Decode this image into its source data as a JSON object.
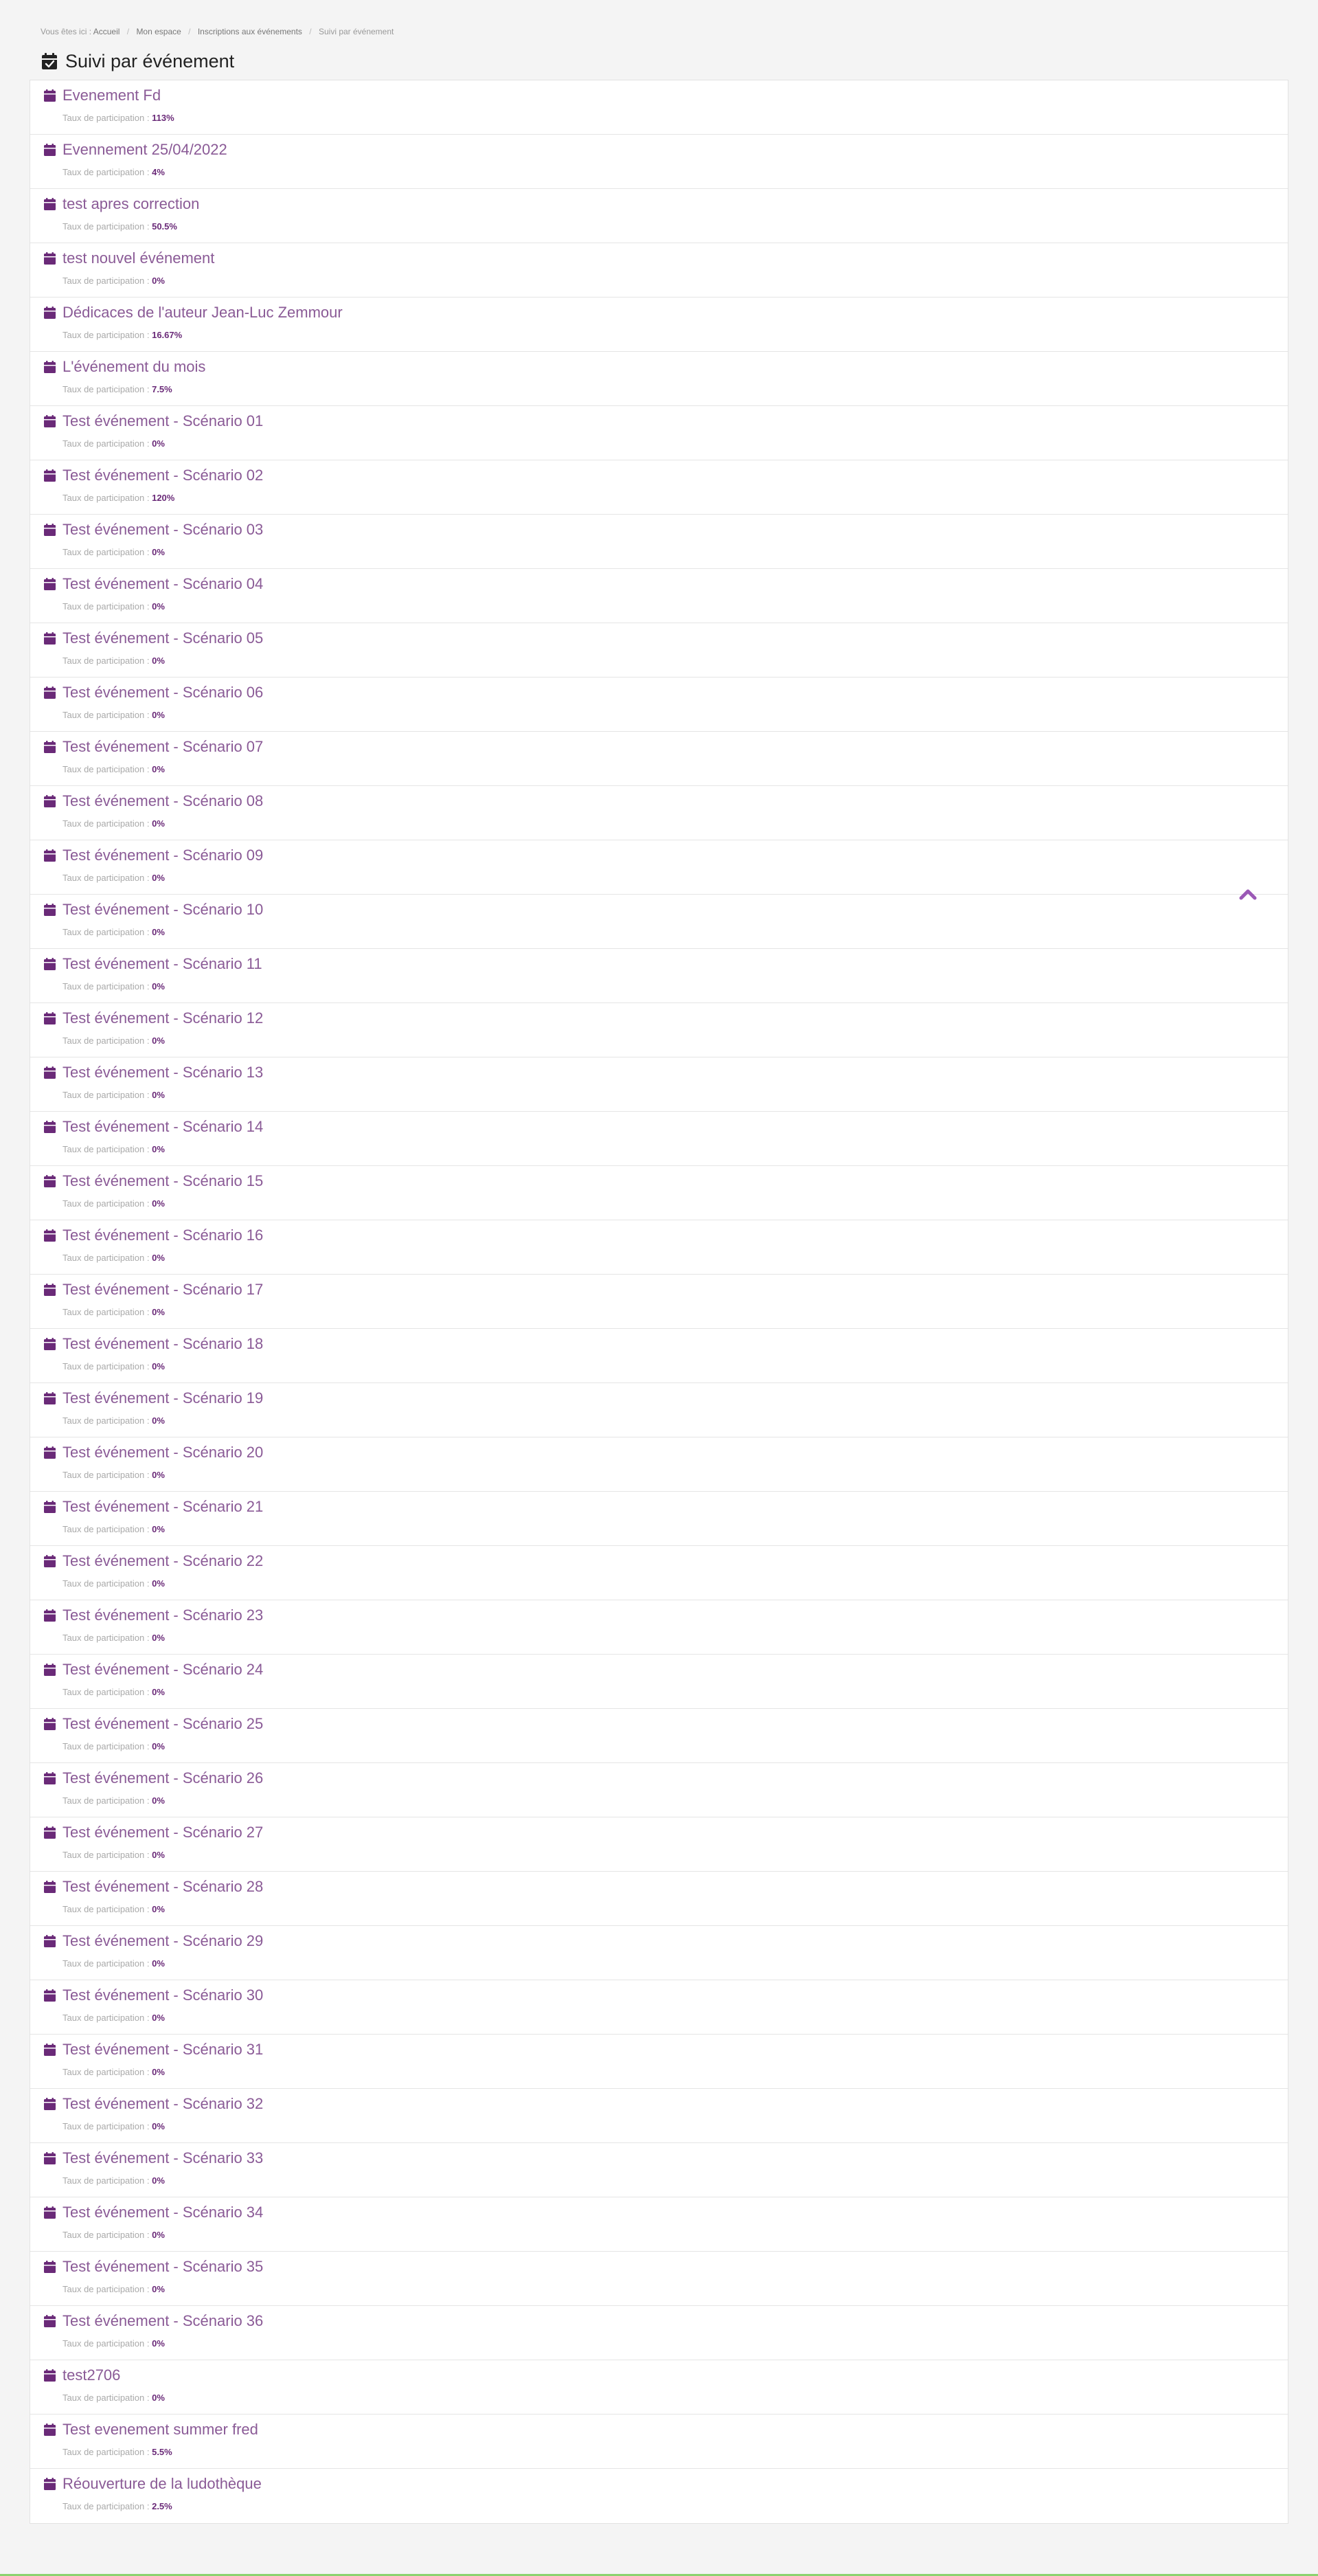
{
  "breadcrumb": {
    "prefix": "Vous êtes ici :",
    "items": [
      "Accueil",
      "Mon espace",
      "Inscriptions aux événements",
      "Suivi par événement"
    ]
  },
  "page_title": "Suivi par événement",
  "rate_label": "Taux de participation :",
  "accent_color": "#6a2a78",
  "events": [
    {
      "title": "Evenement Fd",
      "rate": "113%"
    },
    {
      "title": "Evennement 25/04/2022",
      "rate": "4%"
    },
    {
      "title": "test apres correction",
      "rate": "50.5%"
    },
    {
      "title": "test nouvel événement",
      "rate": "0%"
    },
    {
      "title": "Dédicaces de l'auteur Jean-Luc Zemmour",
      "rate": "16.67%"
    },
    {
      "title": "L'événement du mois",
      "rate": "7.5%"
    },
    {
      "title": "Test événement - Scénario 01",
      "rate": "0%"
    },
    {
      "title": "Test événement - Scénario 02",
      "rate": "120%"
    },
    {
      "title": "Test événement - Scénario 03",
      "rate": "0%"
    },
    {
      "title": "Test événement - Scénario 04",
      "rate": "0%"
    },
    {
      "title": "Test événement - Scénario 05",
      "rate": "0%"
    },
    {
      "title": "Test événement - Scénario 06",
      "rate": "0%"
    },
    {
      "title": "Test événement - Scénario 07",
      "rate": "0%"
    },
    {
      "title": "Test événement - Scénario 08",
      "rate": "0%"
    },
    {
      "title": "Test événement - Scénario 09",
      "rate": "0%"
    },
    {
      "title": "Test événement - Scénario 10",
      "rate": "0%"
    },
    {
      "title": "Test événement - Scénario 11",
      "rate": "0%"
    },
    {
      "title": "Test événement - Scénario 12",
      "rate": "0%"
    },
    {
      "title": "Test événement - Scénario 13",
      "rate": "0%"
    },
    {
      "title": "Test événement - Scénario 14",
      "rate": "0%"
    },
    {
      "title": "Test événement - Scénario 15",
      "rate": "0%"
    },
    {
      "title": "Test événement - Scénario 16",
      "rate": "0%"
    },
    {
      "title": "Test événement - Scénario 17",
      "rate": "0%"
    },
    {
      "title": "Test événement - Scénario 18",
      "rate": "0%"
    },
    {
      "title": "Test événement - Scénario 19",
      "rate": "0%"
    },
    {
      "title": "Test événement - Scénario 20",
      "rate": "0%"
    },
    {
      "title": "Test événement - Scénario 21",
      "rate": "0%"
    },
    {
      "title": "Test événement - Scénario 22",
      "rate": "0%"
    },
    {
      "title": "Test événement - Scénario 23",
      "rate": "0%"
    },
    {
      "title": "Test événement - Scénario 24",
      "rate": "0%"
    },
    {
      "title": "Test événement - Scénario 25",
      "rate": "0%"
    },
    {
      "title": "Test événement - Scénario 26",
      "rate": "0%"
    },
    {
      "title": "Test événement - Scénario 27",
      "rate": "0%"
    },
    {
      "title": "Test événement - Scénario 28",
      "rate": "0%"
    },
    {
      "title": "Test événement - Scénario 29",
      "rate": "0%"
    },
    {
      "title": "Test événement - Scénario 30",
      "rate": "0%"
    },
    {
      "title": "Test événement - Scénario 31",
      "rate": "0%"
    },
    {
      "title": "Test événement - Scénario 32",
      "rate": "0%"
    },
    {
      "title": "Test événement - Scénario 33",
      "rate": "0%"
    },
    {
      "title": "Test événement - Scénario 34",
      "rate": "0%"
    },
    {
      "title": "Test événement - Scénario 35",
      "rate": "0%"
    },
    {
      "title": "Test événement - Scénario 36",
      "rate": "0%"
    },
    {
      "title": "test2706",
      "rate": "0%"
    },
    {
      "title": "Test evenement summer fred",
      "rate": "5.5%"
    },
    {
      "title": "Réouverture de la ludothèque",
      "rate": "2.5%"
    }
  ]
}
